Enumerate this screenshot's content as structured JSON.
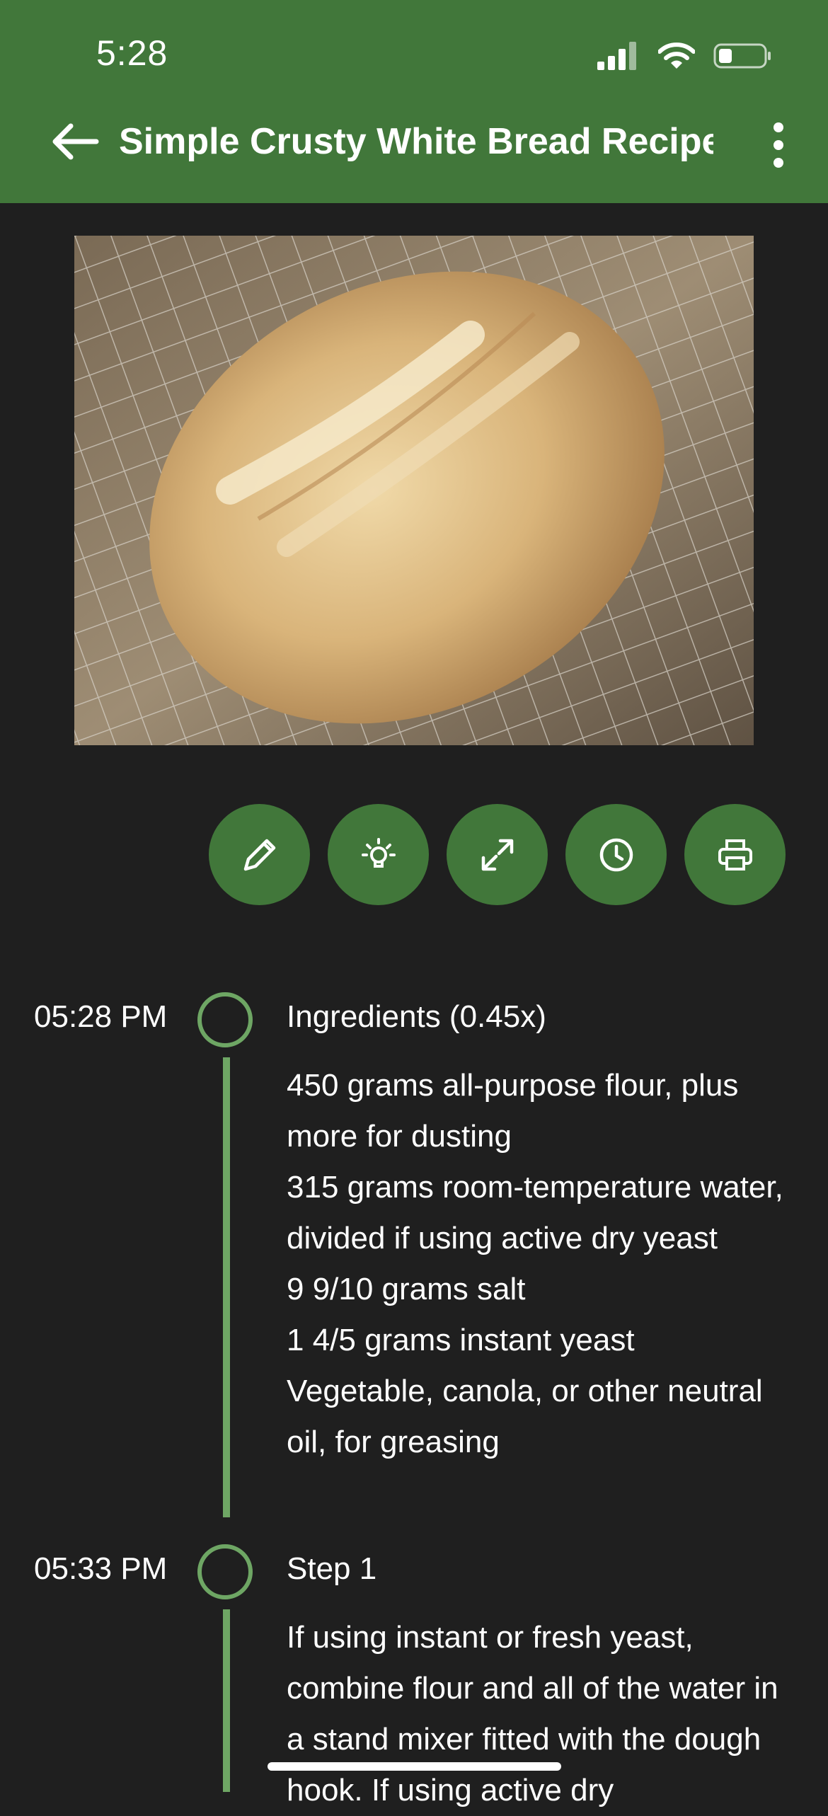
{
  "status_bar": {
    "time": "5:28"
  },
  "header": {
    "title": "Simple Crusty White Bread Recipe"
  },
  "actions": [
    {
      "icon": "pencil-icon"
    },
    {
      "icon": "lightbulb-icon"
    },
    {
      "icon": "expand-icon"
    },
    {
      "icon": "clock-icon"
    },
    {
      "icon": "printer-icon"
    }
  ],
  "timeline": [
    {
      "time": "05:28 PM",
      "heading": "Ingredients (0.45x)",
      "lines": [
        "450 grams all-purpose flour, plus more for dusting",
        "315 grams room-temperature water, divided if using active dry yeast",
        "9 9/10 grams salt",
        "1 4/5 grams instant yeast",
        "Vegetable, canola, or other neutral oil, for greasing"
      ]
    },
    {
      "time": "05:33 PM",
      "heading": "Step 1",
      "lines": [
        "If using instant or fresh yeast, combine flour and all of the water in a stand mixer fitted with the dough hook. If using active dry"
      ]
    }
  ],
  "colors": {
    "header": "#41773a",
    "background": "#1f1f1f",
    "accent": "#6ea664"
  }
}
